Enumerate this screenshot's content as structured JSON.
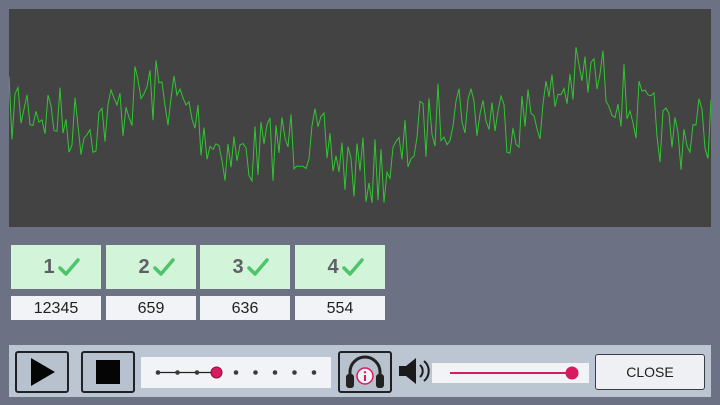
{
  "scope": {
    "trace_color": "#31c631",
    "background": "#434343"
  },
  "channels": [
    {
      "label": "1",
      "count": "12345",
      "icon": "check-icon"
    },
    {
      "label": "2",
      "count": "659",
      "icon": "check-icon"
    },
    {
      "label": "3",
      "count": "636",
      "icon": "check-icon"
    },
    {
      "label": "4",
      "count": "554",
      "icon": "check-icon"
    }
  ],
  "controls": {
    "play_icon": "play-icon",
    "stop_icon": "stop-icon",
    "speed": {
      "steps": 9,
      "selected_step": 3
    },
    "listen_icon": "headphones-info-icon",
    "volume_icon": "speaker-icon",
    "volume_level": 1.0,
    "close_label": "CLOSE"
  },
  "colors": {
    "accent": "#d81b60",
    "channel_bg": "#d2f4d8",
    "check": "#4cc46a"
  }
}
